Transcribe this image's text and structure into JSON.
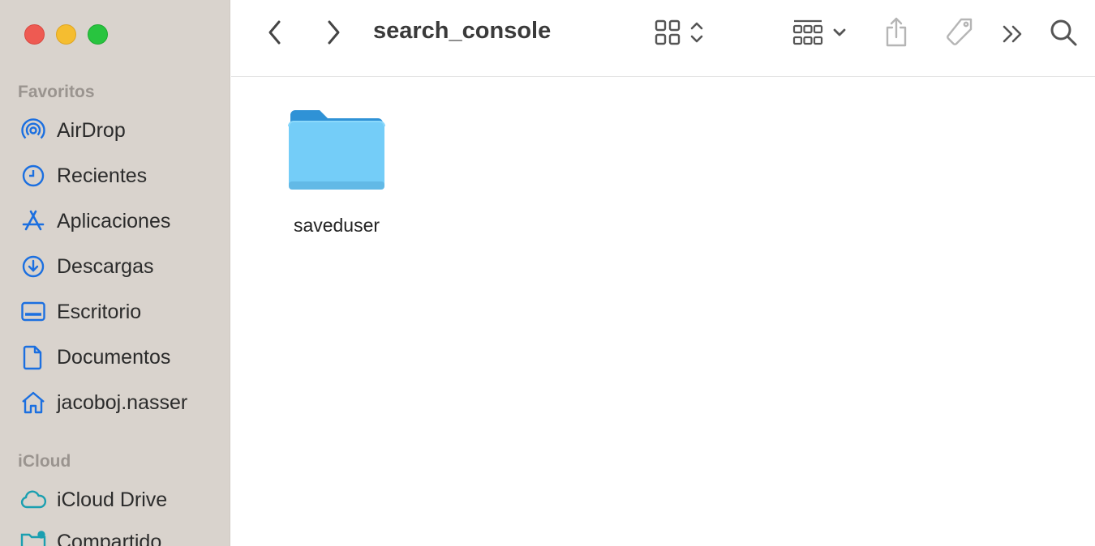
{
  "window": {
    "title": "search_console"
  },
  "toolbar": {
    "back_icon": "chevron-left-icon",
    "forward_icon": "chevron-right-icon",
    "view_icon": "grid-view-icon",
    "group_icon": "group-by-icon",
    "share_icon": "share-icon",
    "tag_icon": "tag-icon",
    "more_icon": "double-chevron-right-icon",
    "search_icon": "search-icon"
  },
  "sidebar": {
    "favorites_title": "Favoritos",
    "favorites": [
      {
        "label": "AirDrop",
        "icon": "airdrop-icon"
      },
      {
        "label": "Recientes",
        "icon": "clock-icon"
      },
      {
        "label": "Aplicaciones",
        "icon": "applications-icon"
      },
      {
        "label": "Descargas",
        "icon": "download-icon"
      },
      {
        "label": "Escritorio",
        "icon": "desktop-icon"
      },
      {
        "label": "Documentos",
        "icon": "document-icon"
      },
      {
        "label": "jacoboj.nasser",
        "icon": "home-icon"
      }
    ],
    "icloud_title": "iCloud",
    "icloud": [
      {
        "label": "iCloud Drive",
        "icon": "cloud-icon"
      },
      {
        "label": "Compartido",
        "icon": "shared-folder-icon"
      }
    ]
  },
  "content": {
    "items": [
      {
        "name": "saveduser",
        "kind": "folder"
      }
    ]
  },
  "colors": {
    "accent": "#1b6fe0",
    "sidebar_bg": "#d9d3cd",
    "folder_front": "#74cdf8",
    "folder_back": "#2f92d6"
  }
}
